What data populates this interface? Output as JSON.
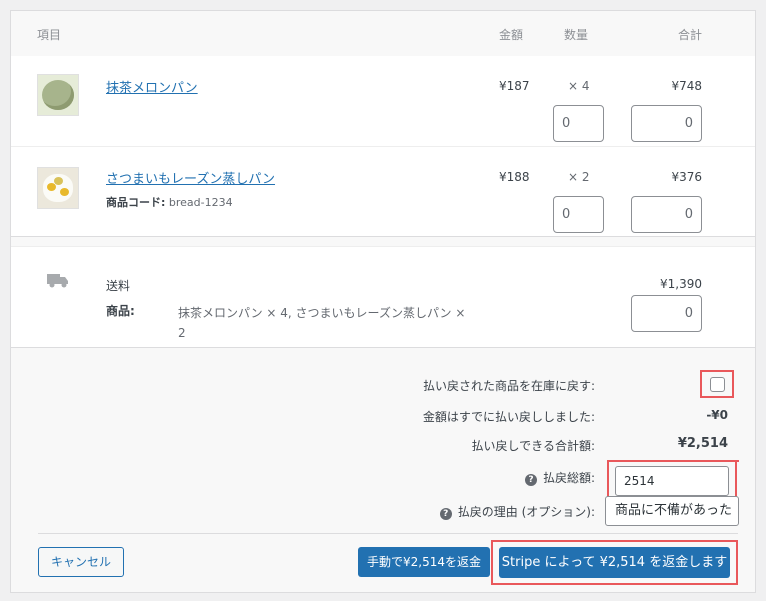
{
  "header": {
    "item": "項目",
    "amount": "金額",
    "quantity": "数量",
    "total": "合計"
  },
  "items": [
    {
      "name": "抹茶メロンパン",
      "price": "¥187",
      "qty": "× 4",
      "refund_qty": "0",
      "line_total": "¥748",
      "refund_total": "0"
    },
    {
      "name": "さつまいもレーズン蒸しパン",
      "sku_label": "商品コード:",
      "sku": "bread-1234",
      "price": "¥188",
      "qty": "× 2",
      "refund_qty": "0",
      "line_total": "¥376",
      "refund_total": "0"
    }
  ],
  "shipping": {
    "label": "送料",
    "items_label": "商品:",
    "items": "抹茶メロンパン × 4, さつまいもレーズン蒸しパン × 2",
    "total": "¥1,390",
    "refund_total": "0",
    "icon": "truck-icon"
  },
  "refund": {
    "restock_label": "払い戻された商品を在庫に戻す:",
    "already_refunded_label": "金額はすでに払い戻ししました:",
    "already_refunded_value": "-¥0",
    "available_label": "払い戻しできる合計額:",
    "available_value": "¥2,514",
    "amount_label": "払戻総額:",
    "amount_value": "2514",
    "reason_label": "払戻の理由 (オプション):",
    "reason_value": "商品に不備があった"
  },
  "buttons": {
    "cancel": "キャンセル",
    "manual": "手動で¥2,514を返金",
    "stripe": "Stripe によって ¥2,514 を返金します"
  },
  "colors": {
    "accent": "#2271b1",
    "highlight": "#e9585b"
  }
}
